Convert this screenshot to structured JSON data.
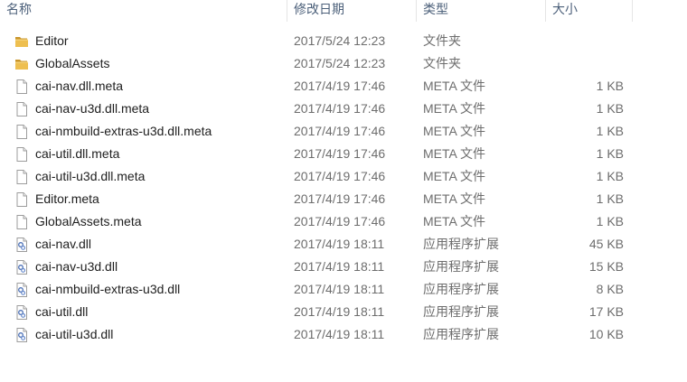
{
  "columns": {
    "name": "名称",
    "date": "修改日期",
    "type": "类型",
    "size": "大小"
  },
  "files": [
    {
      "name": "Editor",
      "date": "2017/5/24 12:23",
      "type": "文件夹",
      "size": "",
      "icon": "folder-icon"
    },
    {
      "name": "GlobalAssets",
      "date": "2017/5/24 12:23",
      "type": "文件夹",
      "size": "",
      "icon": "folder-icon"
    },
    {
      "name": "cai-nav.dll.meta",
      "date": "2017/4/19 17:46",
      "type": "META 文件",
      "size": "1 KB",
      "icon": "document-icon"
    },
    {
      "name": "cai-nav-u3d.dll.meta",
      "date": "2017/4/19 17:46",
      "type": "META 文件",
      "size": "1 KB",
      "icon": "document-icon"
    },
    {
      "name": "cai-nmbuild-extras-u3d.dll.meta",
      "date": "2017/4/19 17:46",
      "type": "META 文件",
      "size": "1 KB",
      "icon": "document-icon"
    },
    {
      "name": "cai-util.dll.meta",
      "date": "2017/4/19 17:46",
      "type": "META 文件",
      "size": "1 KB",
      "icon": "document-icon"
    },
    {
      "name": "cai-util-u3d.dll.meta",
      "date": "2017/4/19 17:46",
      "type": "META 文件",
      "size": "1 KB",
      "icon": "document-icon"
    },
    {
      "name": "Editor.meta",
      "date": "2017/4/19 17:46",
      "type": "META 文件",
      "size": "1 KB",
      "icon": "document-icon"
    },
    {
      "name": "GlobalAssets.meta",
      "date": "2017/4/19 17:46",
      "type": "META 文件",
      "size": "1 KB",
      "icon": "document-icon"
    },
    {
      "name": "cai-nav.dll",
      "date": "2017/4/19 18:11",
      "type": "应用程序扩展",
      "size": "45 KB",
      "icon": "dll-icon"
    },
    {
      "name": "cai-nav-u3d.dll",
      "date": "2017/4/19 18:11",
      "type": "应用程序扩展",
      "size": "15 KB",
      "icon": "dll-icon"
    },
    {
      "name": "cai-nmbuild-extras-u3d.dll",
      "date": "2017/4/19 18:11",
      "type": "应用程序扩展",
      "size": "8 KB",
      "icon": "dll-icon"
    },
    {
      "name": "cai-util.dll",
      "date": "2017/4/19 18:11",
      "type": "应用程序扩展",
      "size": "17 KB",
      "icon": "dll-icon"
    },
    {
      "name": "cai-util-u3d.dll",
      "date": "2017/4/19 18:11",
      "type": "应用程序扩展",
      "size": "10 KB",
      "icon": "dll-icon"
    }
  ],
  "colors": {
    "folder": "#e8b848",
    "folder_dark": "#c9952a",
    "header_text": "#4c607a",
    "dll_accent": "#4a6fb5"
  }
}
